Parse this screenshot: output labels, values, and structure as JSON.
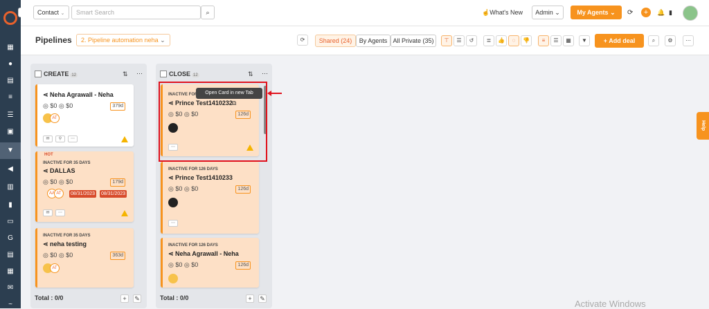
{
  "topbar": {
    "contact_select": "Contact",
    "search_placeholder": "Smart Search",
    "whats_new": "What's New",
    "admin_select": "Admin",
    "my_agents": "My Agents",
    "plus_icon": "+"
  },
  "subbar": {
    "title": "Pipelines",
    "pipeline_select": "2. Pipeline automation neha",
    "shared": "Shared (24)",
    "by_agents": "By Agents",
    "all_private": "All Private (35)",
    "add_deal": "Add deal"
  },
  "columns": [
    {
      "title": "CREATE",
      "count": "12",
      "total": "Total : 0/0",
      "cards": [
        {
          "name": "Neha Agrawall - Neha",
          "amount1": "$0",
          "amount2": "$0",
          "days": "379d",
          "avatar2": "AT"
        },
        {
          "hot": "HOT",
          "inactive": "INACTIVE FOR 35 DAYS",
          "name": "DALLAS",
          "amount1": "$0",
          "amount2": "$0",
          "days": "179d",
          "avatar1": "AA",
          "avatar2": "AT",
          "date1": "08/31/2023",
          "date2": "08/31/2023"
        },
        {
          "inactive": "INACTIVE FOR 35 DAYS",
          "name": "neha testing",
          "amount1": "$0",
          "amount2": "$0",
          "days": "363d",
          "avatar2": "AT"
        }
      ]
    },
    {
      "title": "CLOSE",
      "count": "12",
      "total": "Total : 0/0",
      "cards": [
        {
          "inactive": "INACTIVE FOR",
          "name": "Prince Test1410232",
          "amount1": "$0",
          "amount2": "$0",
          "days": "126d"
        },
        {
          "inactive": "INACTIVE FOR 126 DAYS",
          "name": "Prince Test1410233",
          "amount1": "$0",
          "amount2": "$0",
          "days": "126d"
        },
        {
          "inactive": "INACTIVE FOR 126 DAYS",
          "name": "Neha Agrawall - Neha",
          "amount1": "$0",
          "amount2": "$0",
          "days": "126d"
        }
      ]
    }
  ],
  "tooltip": "Open Card in new Tab",
  "help": "Help",
  "watermark": "Activate Windows",
  "colors": {
    "accent": "#f7931e",
    "sidebar": "#2c3e50",
    "highlight": "#e0101b"
  }
}
